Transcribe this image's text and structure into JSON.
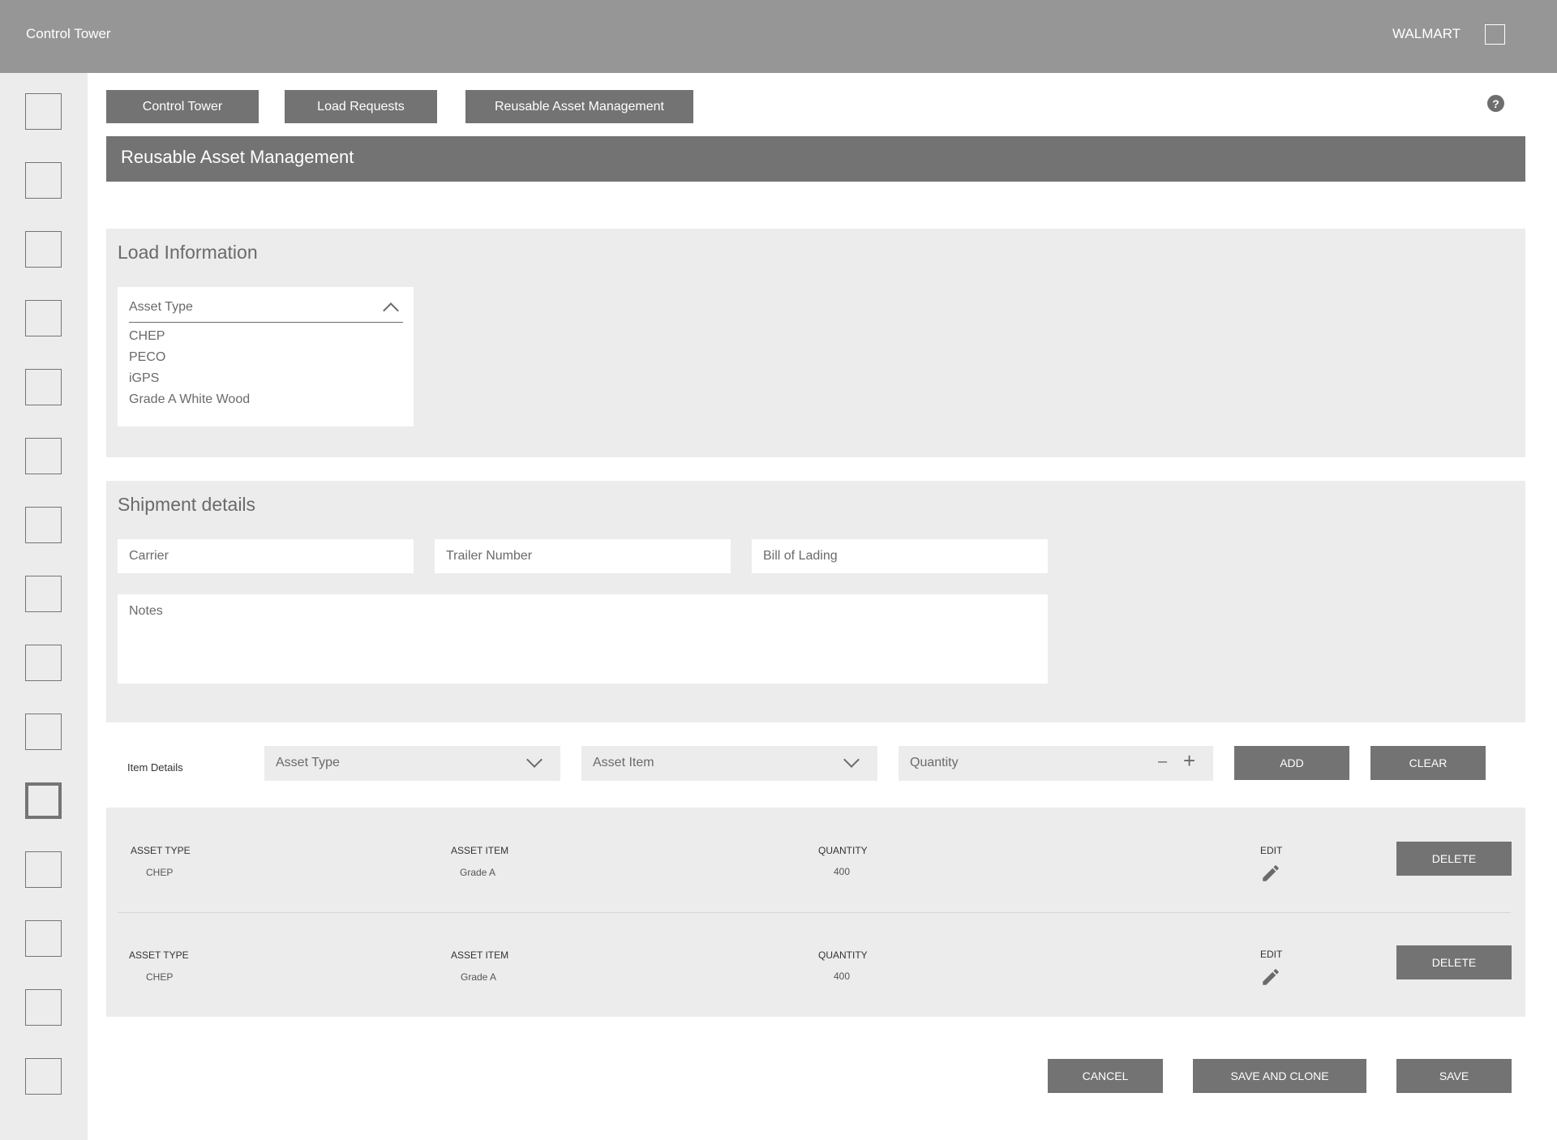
{
  "header": {
    "app_title": "Control Tower",
    "org_name": "WALMART"
  },
  "sidebar": {
    "items": 15,
    "active_index": 10
  },
  "tabs": [
    "Control Tower",
    "Load Requests",
    "Reusable Asset Management"
  ],
  "page_title": "Reusable Asset Management",
  "load_information": {
    "title": "Load Information",
    "asset_type_dropdown": {
      "label": "Asset Type",
      "options": [
        "CHEP",
        "PECO",
        "iGPS",
        "Grade A White Wood"
      ]
    }
  },
  "shipment_details": {
    "title": "Shipment details",
    "carrier_placeholder": "Carrier",
    "trailer_placeholder": "Trailer Number",
    "bol_placeholder": "Bill of Lading",
    "notes_placeholder": "Notes"
  },
  "item_details": {
    "label": "Item Details",
    "asset_type_placeholder": "Asset Type",
    "asset_item_placeholder": "Asset Item",
    "quantity_placeholder": "Quantity",
    "minus": "–",
    "plus": "+",
    "add_label": "ADD",
    "clear_label": "CLEAR"
  },
  "items_table": {
    "headers": {
      "asset_type": "ASSET TYPE",
      "asset_item": "ASSET ITEM",
      "quantity": "QUANTITY",
      "edit": "EDIT"
    },
    "delete_label": "DELETE",
    "rows": [
      {
        "asset_type": "CHEP",
        "asset_item": "Grade A",
        "quantity": "400"
      },
      {
        "asset_type": "CHEP",
        "asset_item": "Grade A",
        "quantity": "400"
      }
    ]
  },
  "footer": {
    "cancel_label": "CANCEL",
    "save_clone_label": "SAVE AND CLONE",
    "save_label": "SAVE"
  },
  "colors": {
    "topbar": "#969696",
    "button": "#737373",
    "panel": "#ececec",
    "sidebar": "#ececec"
  }
}
